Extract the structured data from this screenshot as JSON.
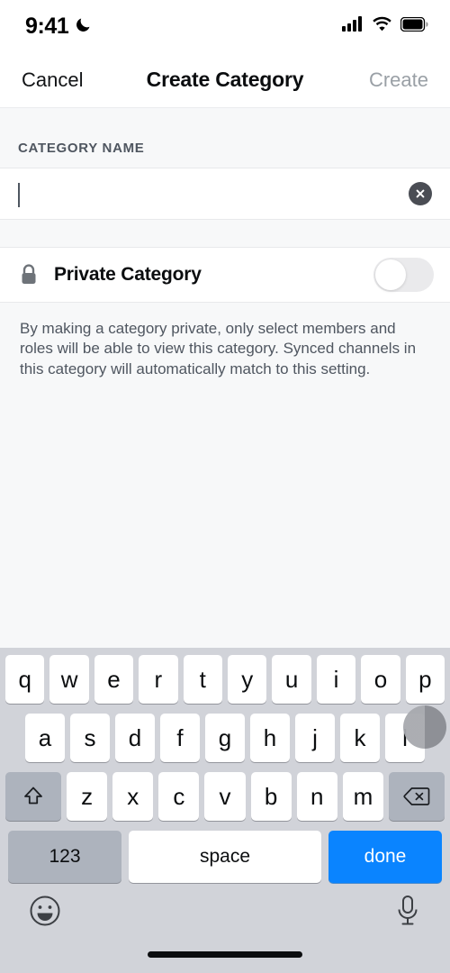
{
  "status_bar": {
    "time": "9:41",
    "dnd_icon": "moon-icon",
    "cellular_icon": "cellular-signal-icon",
    "wifi_icon": "wifi-icon",
    "battery_icon": "battery-full-icon"
  },
  "nav": {
    "cancel_label": "Cancel",
    "title": "Create Category",
    "create_label": "Create",
    "create_enabled": false
  },
  "form": {
    "section_header": "CATEGORY NAME",
    "name_value": "",
    "name_placeholder": "",
    "clear_icon": "clear-circle-icon"
  },
  "private": {
    "lock_icon": "lock-icon",
    "label": "Private Category",
    "toggle_state": "off",
    "helper_text": "By making a category private, only select members and roles will be able to view this category. Synced channels in this category will automatically match to this setting."
  },
  "keyboard": {
    "row1": [
      "q",
      "w",
      "e",
      "r",
      "t",
      "y",
      "u",
      "i",
      "o",
      "p"
    ],
    "row2": [
      "a",
      "s",
      "d",
      "f",
      "g",
      "h",
      "j",
      "k",
      "l"
    ],
    "row3": [
      "z",
      "x",
      "c",
      "v",
      "b",
      "n",
      "m"
    ],
    "shift_icon": "shift-arrow-icon",
    "backspace_icon": "backspace-icon",
    "num_label": "123",
    "space_label": "space",
    "done_label": "done",
    "emoji_icon": "emoji-smiley-icon",
    "mic_icon": "microphone-icon"
  },
  "colors": {
    "accent_blue": "#0A84FF",
    "disabled_gray": "#9AA0A6",
    "keyboard_bg": "#D1D3D9",
    "content_bg": "#F7F8F9",
    "toggle_off_track": "#EAEAEC"
  }
}
